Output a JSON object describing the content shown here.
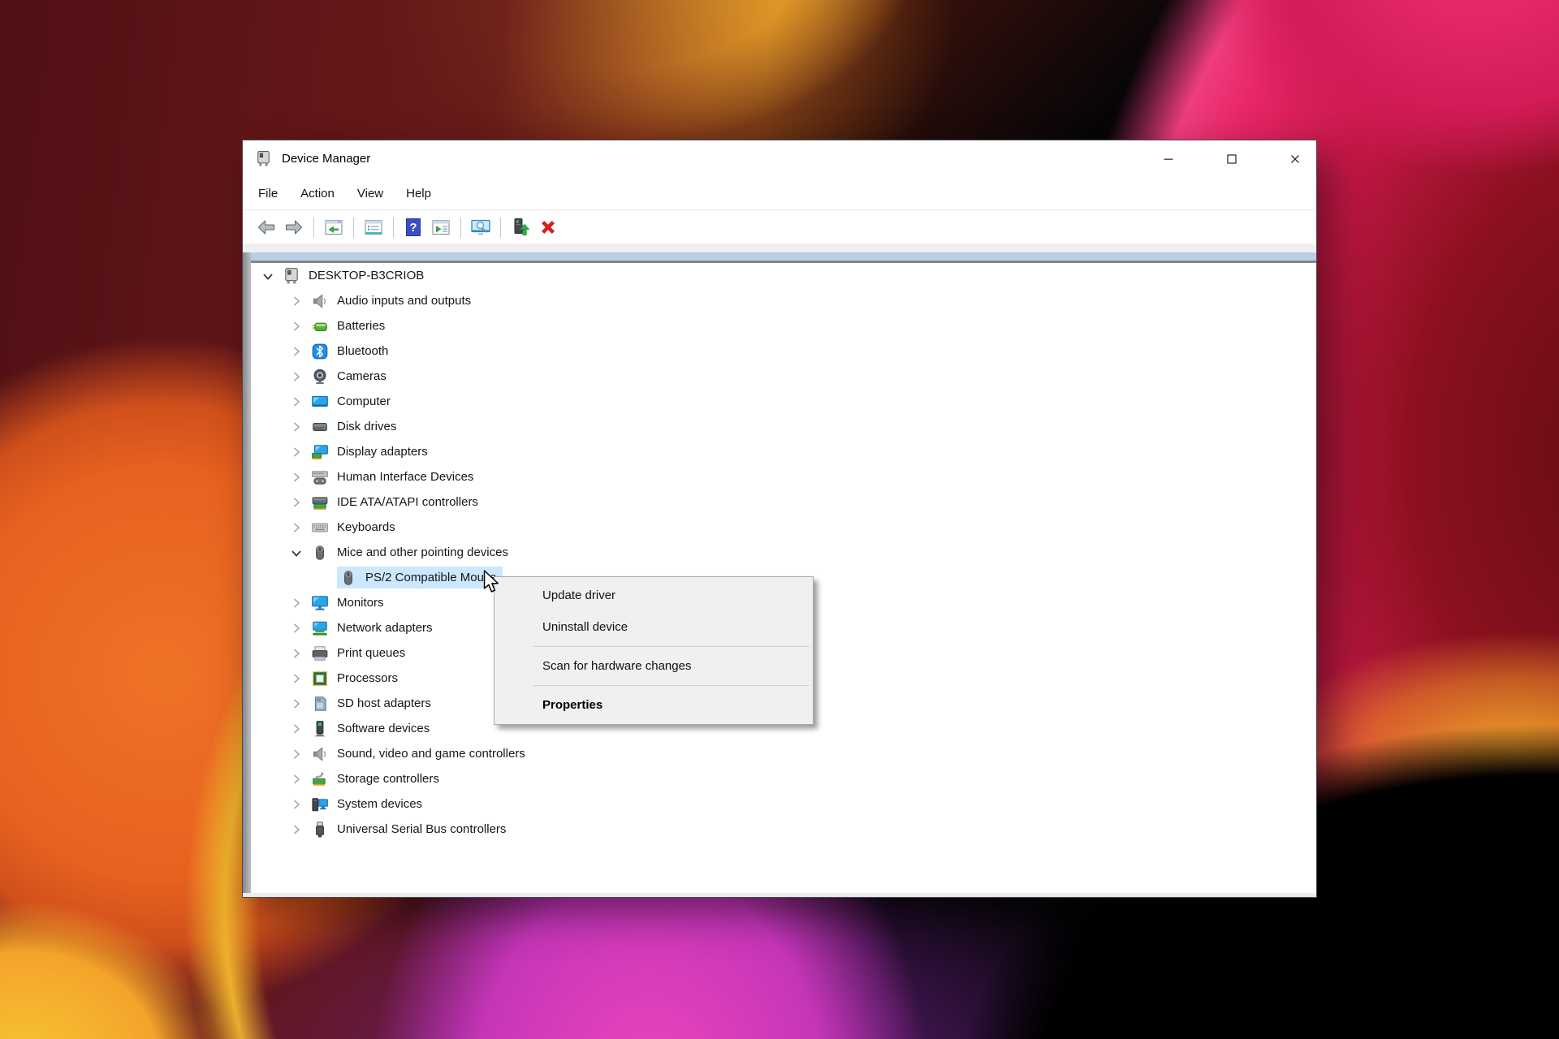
{
  "window": {
    "title": "Device Manager",
    "title_icon": "device-manager-icon",
    "caption_buttons": [
      "minimize",
      "maximize",
      "close"
    ],
    "menu": [
      "File",
      "Action",
      "View",
      "Help"
    ]
  },
  "toolbar": {
    "icons": [
      "back-icon",
      "forward-icon",
      "separator",
      "console-tree-icon",
      "separator",
      "properties-icon",
      "separator",
      "help-icon",
      "action-pane-icon",
      "separator",
      "scan-hardware-icon",
      "separator",
      "update-driver-icon",
      "uninstall-device-icon"
    ]
  },
  "tree": {
    "items": [
      {
        "label": "DESKTOP-B3CRIOB",
        "icon": "device-manager-icon",
        "level": 0,
        "state": "expanded",
        "selected": false
      },
      {
        "label": "Audio inputs and outputs",
        "icon": "speaker-icon",
        "level": 1,
        "state": "collapsed",
        "selected": false
      },
      {
        "label": "Batteries",
        "icon": "battery-icon",
        "level": 1,
        "state": "collapsed",
        "selected": false
      },
      {
        "label": "Bluetooth",
        "icon": "bluetooth-icon",
        "level": 1,
        "state": "collapsed",
        "selected": false
      },
      {
        "label": "Cameras",
        "icon": "camera-icon",
        "level": 1,
        "state": "collapsed",
        "selected": false
      },
      {
        "label": "Computer",
        "icon": "monitor-icon",
        "level": 1,
        "state": "collapsed",
        "selected": false
      },
      {
        "label": "Disk drives",
        "icon": "disk-icon",
        "level": 1,
        "state": "collapsed",
        "selected": false
      },
      {
        "label": "Display adapters",
        "icon": "display-adapter-icon",
        "level": 1,
        "state": "collapsed",
        "selected": false
      },
      {
        "label": "Human Interface Devices",
        "icon": "hid-icon",
        "level": 1,
        "state": "collapsed",
        "selected": false
      },
      {
        "label": "IDE ATA/ATAPI controllers",
        "icon": "ide-icon",
        "level": 1,
        "state": "collapsed",
        "selected": false
      },
      {
        "label": "Keyboards",
        "icon": "keyboard-icon",
        "level": 1,
        "state": "collapsed",
        "selected": false
      },
      {
        "label": "Mice and other pointing devices",
        "icon": "mouse-icon",
        "level": 1,
        "state": "expanded",
        "selected": false
      },
      {
        "label": "PS/2 Compatible Mouse",
        "icon": "mouse-icon",
        "level": 2,
        "state": "leaf",
        "selected": true
      },
      {
        "label": "Monitors",
        "icon": "monitor-stand-icon",
        "level": 1,
        "state": "collapsed",
        "selected": false
      },
      {
        "label": "Network adapters",
        "icon": "network-adapter-icon",
        "level": 1,
        "state": "collapsed",
        "selected": false
      },
      {
        "label": "Print queues",
        "icon": "printer-icon",
        "level": 1,
        "state": "collapsed",
        "selected": false
      },
      {
        "label": "Processors",
        "icon": "cpu-icon",
        "level": 1,
        "state": "collapsed",
        "selected": false
      },
      {
        "label": "SD host adapters",
        "icon": "sd-card-icon",
        "level": 1,
        "state": "collapsed",
        "selected": false
      },
      {
        "label": "Software devices",
        "icon": "software-device-icon",
        "level": 1,
        "state": "collapsed",
        "selected": false
      },
      {
        "label": "Sound, video and game controllers",
        "icon": "speaker-icon",
        "level": 1,
        "state": "collapsed",
        "selected": false
      },
      {
        "label": "Storage controllers",
        "icon": "storage-controller-icon",
        "level": 1,
        "state": "collapsed",
        "selected": false
      },
      {
        "label": "System devices",
        "icon": "system-device-icon",
        "level": 1,
        "state": "collapsed",
        "selected": false
      },
      {
        "label": "Universal Serial Bus controllers",
        "icon": "usb-icon",
        "level": 1,
        "state": "collapsed",
        "selected": false
      }
    ]
  },
  "context_menu": {
    "items": [
      {
        "label": "Update driver",
        "bold": false,
        "divider_after": false
      },
      {
        "label": "Uninstall device",
        "bold": false,
        "divider_after": true
      },
      {
        "label": "Scan for hardware changes",
        "bold": false,
        "divider_after": true
      },
      {
        "label": "Properties",
        "bold": true,
        "divider_after": false
      }
    ]
  },
  "colors": {
    "selection_highlight": "#cce8ff",
    "context_menu_bg": "#f0f0f0",
    "tree_band_blue": "#b9cfe6"
  }
}
